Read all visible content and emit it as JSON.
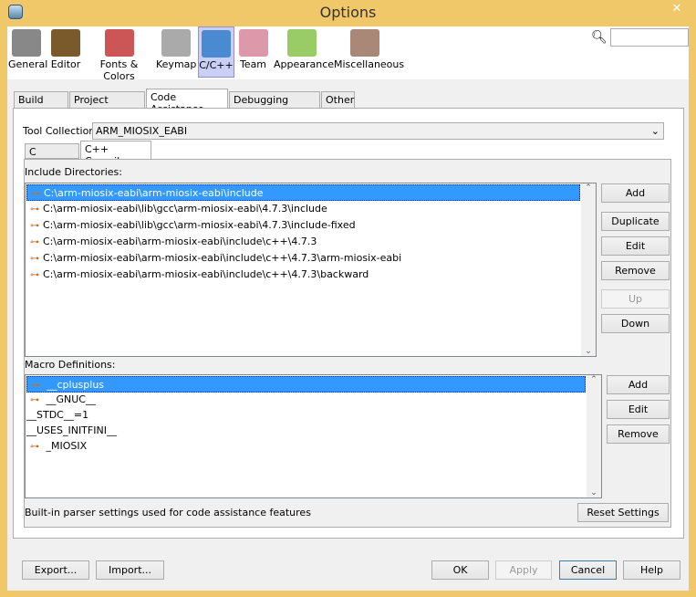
{
  "window": {
    "title": "Options",
    "close_icon": "close-icon"
  },
  "toolbar": {
    "items": [
      {
        "label": "General",
        "icon": "wrench-gear-icon",
        "color": "#888"
      },
      {
        "label": "Editor",
        "icon": "book-pencil-icon",
        "color": "#7a5a2a"
      },
      {
        "label": "Fonts & Colors",
        "icon": "font-icon",
        "color": "#c55"
      },
      {
        "label": "Keymap",
        "icon": "keyboard-icon",
        "color": "#aaa"
      },
      {
        "label": "C/C++",
        "icon": "cpp-icon",
        "color": "#4a8ad0"
      },
      {
        "label": "Team",
        "icon": "cubes-icon",
        "color": "#d9a"
      },
      {
        "label": "Appearance",
        "icon": "appearance-icon",
        "color": "#9c6"
      },
      {
        "label": "Miscellaneous",
        "icon": "misc-icon",
        "color": "#a87"
      }
    ],
    "selected": "C/C++"
  },
  "tabs": [
    "Build Tools",
    "Project Options",
    "Code Assistance",
    "Debugging Options",
    "Other"
  ],
  "selected_tab": "Code Assistance",
  "tool_collection": {
    "label": "Tool Collection:",
    "value": "ARM_MIOSIX_EABI"
  },
  "subtabs": [
    "C Compiler",
    "C++ Compiler"
  ],
  "selected_subtab": "C++ Compiler",
  "include": {
    "label": "Include Directories:",
    "items": [
      "C:\\arm-miosix-eabi\\arm-miosix-eabi\\include",
      "C:\\arm-miosix-eabi\\lib\\gcc\\arm-miosix-eabi\\4.7.3\\include",
      "C:\\arm-miosix-eabi\\lib\\gcc\\arm-miosix-eabi\\4.7.3\\include-fixed",
      "C:\\arm-miosix-eabi\\arm-miosix-eabi\\include\\c++\\4.7.3",
      "C:\\arm-miosix-eabi\\arm-miosix-eabi\\include\\c++\\4.7.3\\arm-miosix-eabi",
      "C:\\arm-miosix-eabi\\arm-miosix-eabi\\include\\c++\\4.7.3\\backward"
    ],
    "buttons": {
      "add": "Add",
      "duplicate": "Duplicate",
      "edit": "Edit",
      "remove": "Remove",
      "up": "Up",
      "down": "Down"
    }
  },
  "macros": {
    "label": "Macro Definitions:",
    "items": [
      {
        "text": "__cplusplus",
        "key": true
      },
      {
        "text": "__GNUC__",
        "key": true
      },
      {
        "text": "__STDC__=1",
        "key": false
      },
      {
        "text": "__USES_INITFINI__",
        "key": false
      },
      {
        "text": "_MIOSIX",
        "key": true
      }
    ],
    "buttons": {
      "add": "Add",
      "edit": "Edit",
      "remove": "Remove"
    }
  },
  "footer_note": "Built-in parser settings used for code assistance features",
  "reset": "Reset Settings",
  "bottom": {
    "export": "Export...",
    "import": "Import...",
    "ok": "OK",
    "apply": "Apply",
    "cancel": "Cancel",
    "help": "Help"
  }
}
